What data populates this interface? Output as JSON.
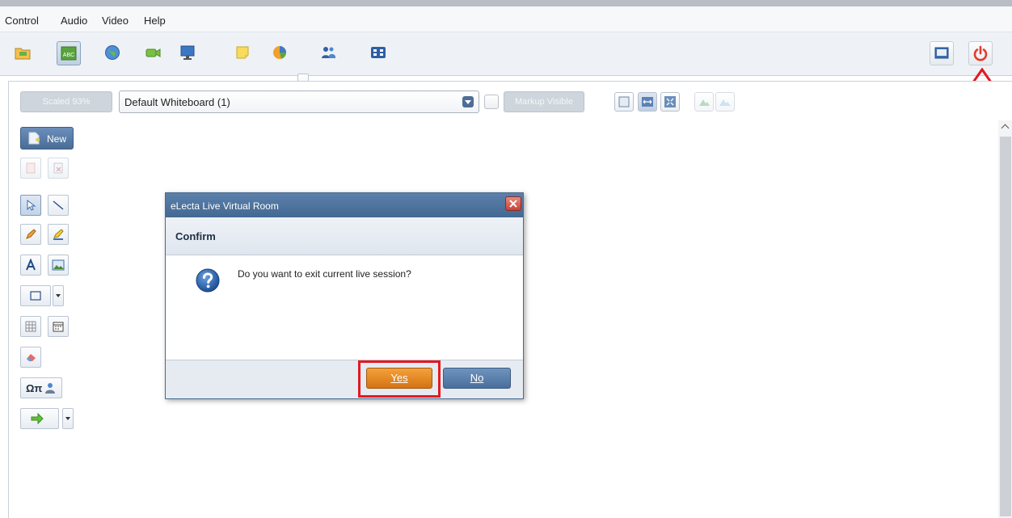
{
  "menu": {
    "items": [
      "Control",
      "Audio",
      "Video",
      "Help"
    ]
  },
  "toolbar": {
    "buttons": [
      "folder-icon",
      "text-abc-icon",
      "globe-icon",
      "camera-icon",
      "monitor-icon",
      "sticky-note-icon",
      "pie-chart-icon",
      "users-icon",
      "film-icon",
      "video-layout-icon",
      "power-icon"
    ],
    "abc_label": "ABC",
    "exit_color": "#e53a2a"
  },
  "whiteboard_bar": {
    "scale_label": "Scaled 93%",
    "whiteboard_selected": "Default Whiteboard (1)",
    "markup_label": "Markup Visible"
  },
  "tools": {
    "new_label": "New",
    "symbols_label": "Ωπ"
  },
  "dialog": {
    "title": "eLecta Live Virtual Room",
    "header": "Confirm",
    "message": "Do you want to exit current live session?",
    "yes_label": "Yes",
    "no_label": "No",
    "highlight_color": "#e3191f"
  }
}
